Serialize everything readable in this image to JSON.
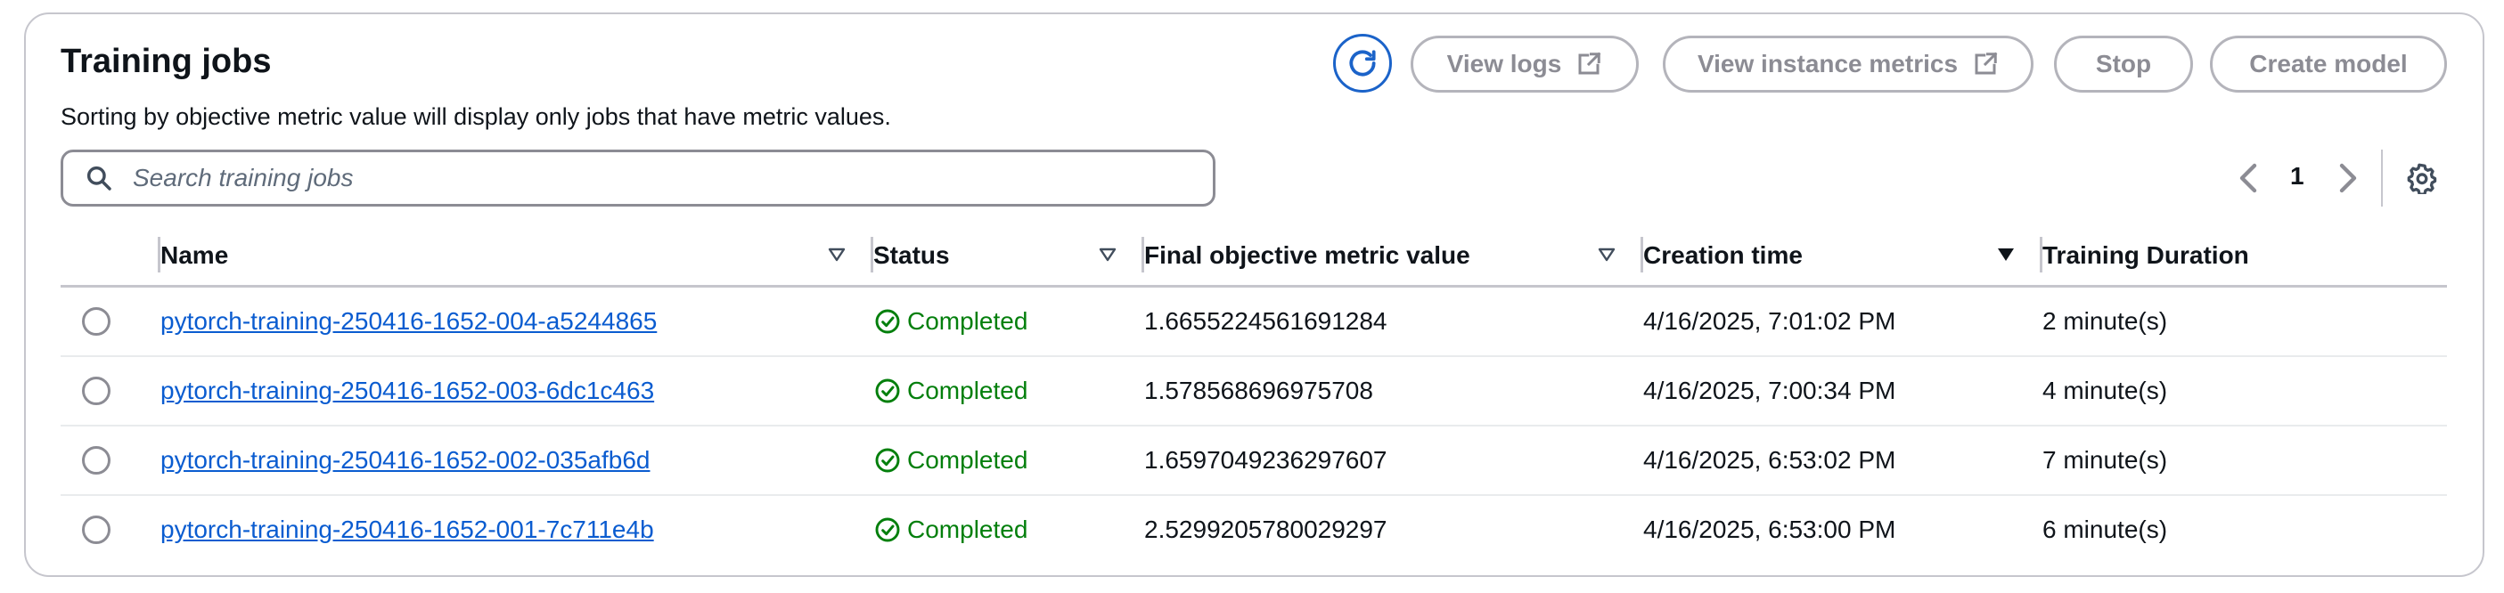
{
  "header": {
    "title": "Training jobs",
    "subtitle": "Sorting by objective metric value will display only jobs that have metric values."
  },
  "toolbar": {
    "view_logs": "View logs",
    "view_instance_metrics": "View instance metrics",
    "stop": "Stop",
    "create_model": "Create model"
  },
  "search": {
    "placeholder": "Search training jobs"
  },
  "pagination": {
    "current_page": "1"
  },
  "table": {
    "columns": [
      "Name",
      "Status",
      "Final objective metric value",
      "Creation time",
      "Training Duration"
    ],
    "rows": [
      {
        "name": "pytorch-training-250416-1652-004-a5244865",
        "status": "Completed",
        "metric": "1.6655224561691284",
        "created": "4/16/2025, 7:01:02 PM",
        "duration": "2 minute(s)"
      },
      {
        "name": "pytorch-training-250416-1652-003-6dc1c463",
        "status": "Completed",
        "metric": "1.578568696975708",
        "created": "4/16/2025, 7:00:34 PM",
        "duration": "4 minute(s)"
      },
      {
        "name": "pytorch-training-250416-1652-002-035afb6d",
        "status": "Completed",
        "metric": "1.6597049236297607",
        "created": "4/16/2025, 6:53:02 PM",
        "duration": "7 minute(s)"
      },
      {
        "name": "pytorch-training-250416-1652-001-7c711e4b",
        "status": "Completed",
        "metric": "2.5299205780029297",
        "created": "4/16/2025, 6:53:00 PM",
        "duration": "6 minute(s)"
      }
    ]
  },
  "icons": {
    "refresh": "refresh-icon",
    "external": "external-link-icon",
    "search": "search-icon",
    "prev": "chevron-left-icon",
    "next": "chevron-right-icon",
    "settings": "gear-icon",
    "sort": "caret-down-icon",
    "status": "check-circle-icon"
  },
  "colors": {
    "accent": "#0a5cd0",
    "success": "#037f0c",
    "disabled": "#8c8c94",
    "border": "#c6c6cd"
  }
}
